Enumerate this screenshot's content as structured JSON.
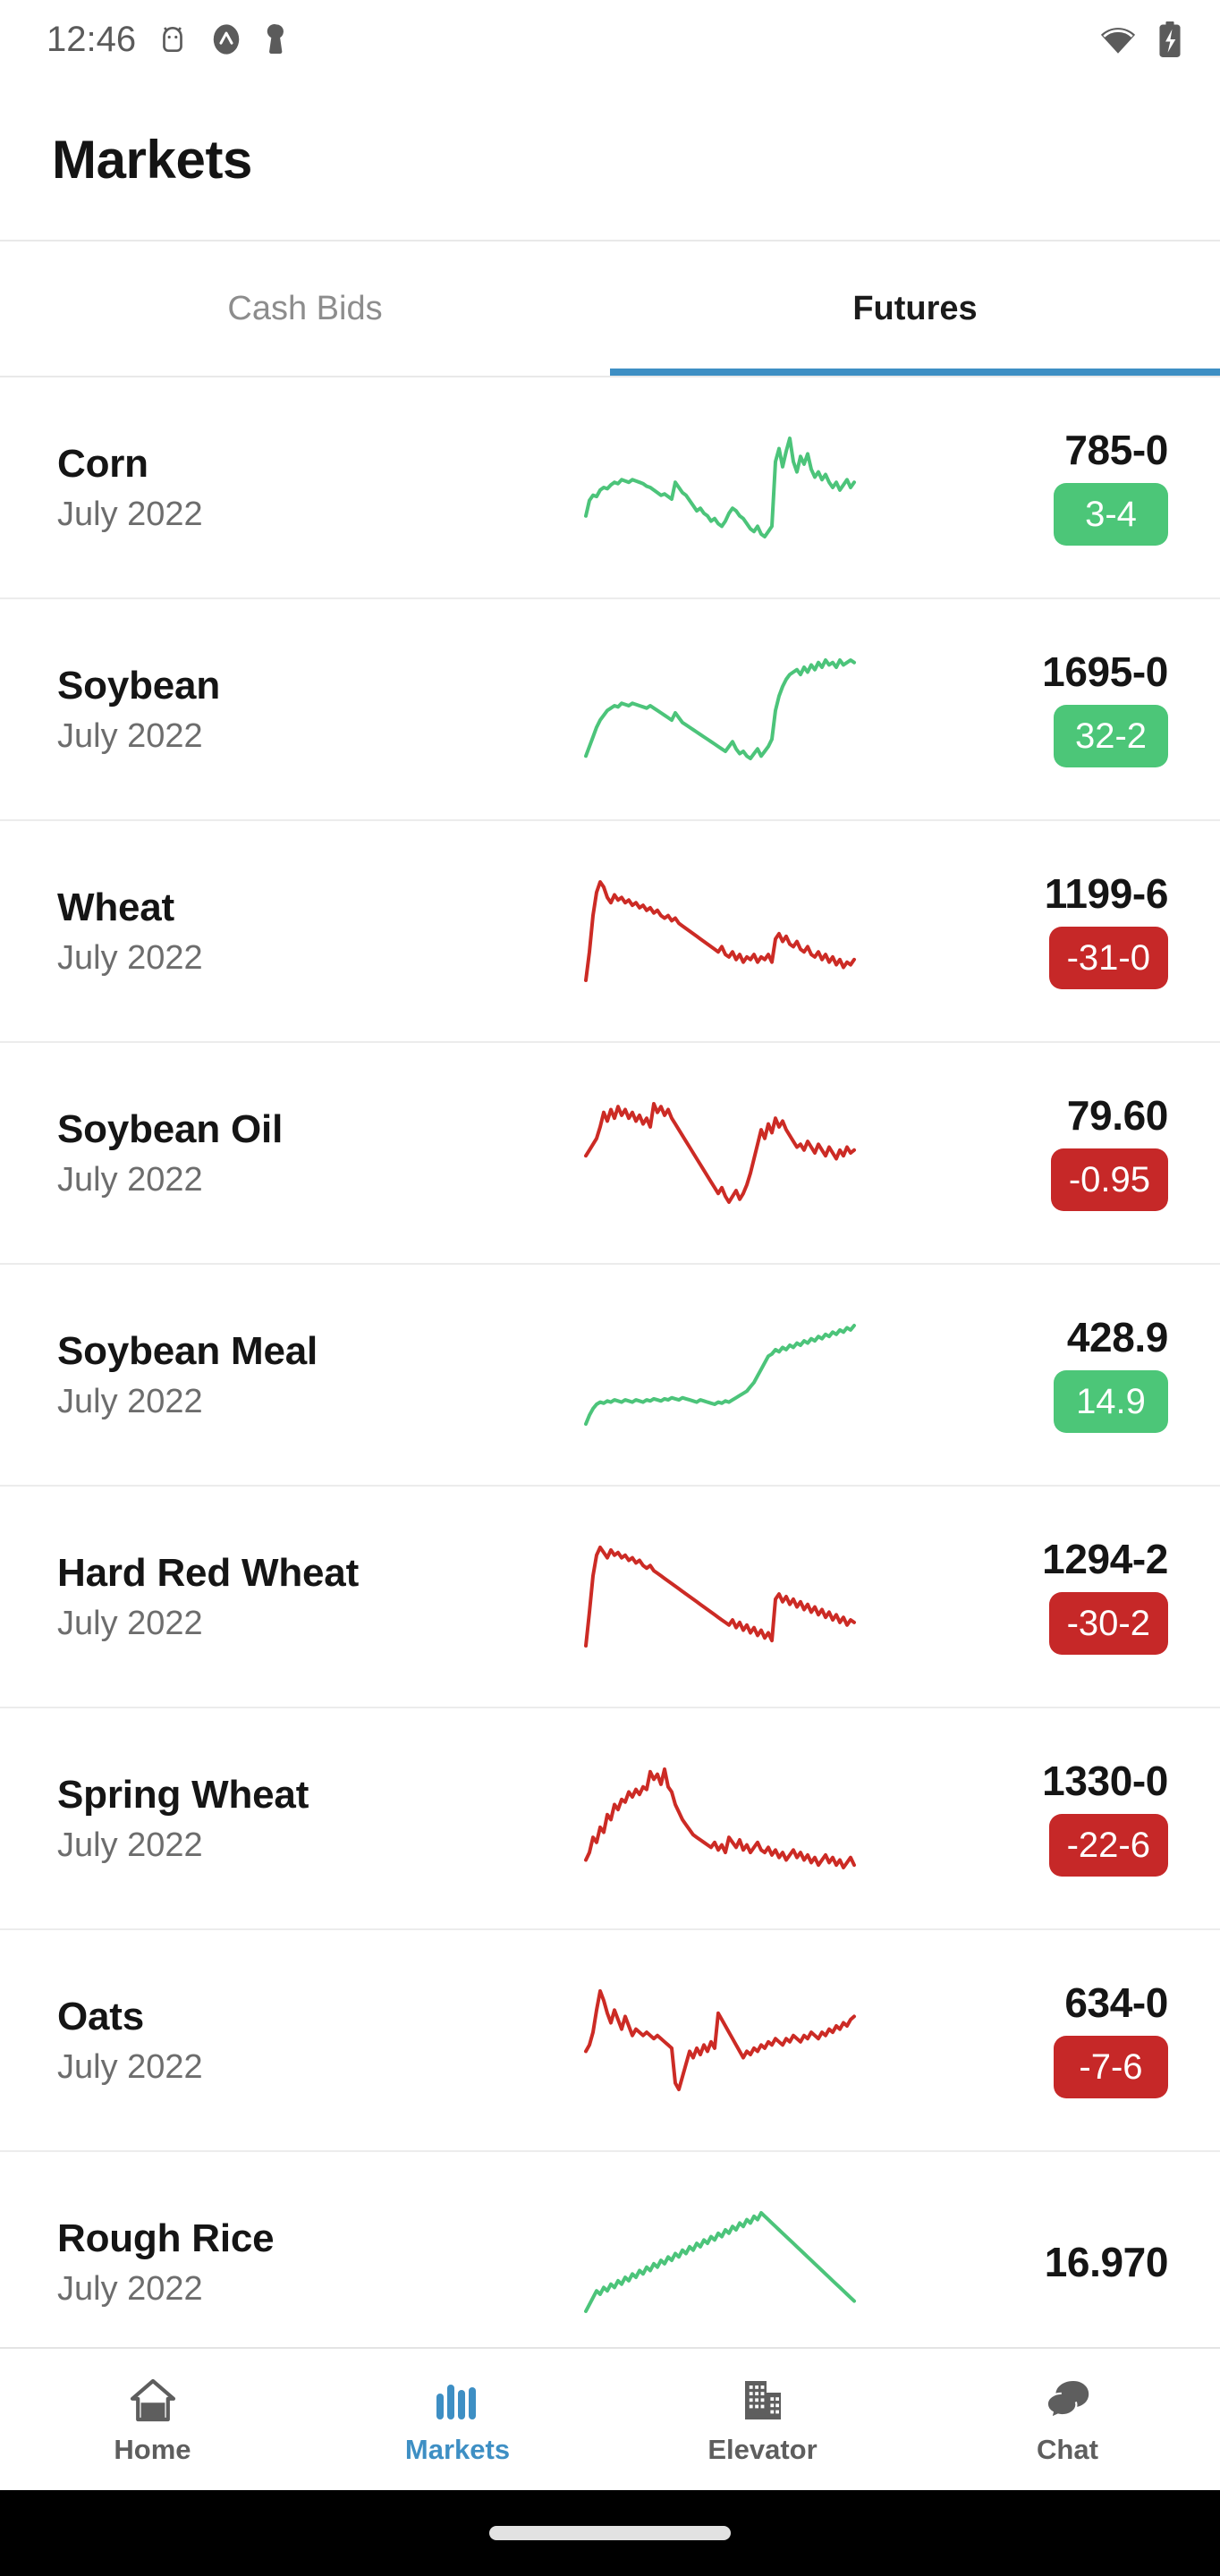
{
  "status_bar": {
    "time": "12:46",
    "icons": [
      "android-debug-icon",
      "app-badge-icon",
      "keyhole-icon"
    ],
    "right_icons": [
      "wifi-icon",
      "battery-charging-icon"
    ]
  },
  "app_bar": {
    "title": "Markets"
  },
  "tabs": [
    {
      "label": "Cash Bids",
      "active": false
    },
    {
      "label": "Futures",
      "active": true
    }
  ],
  "colors": {
    "accent_blue": "#3e8fc4",
    "up_green": "#4cc678",
    "down_red": "#c62828",
    "spark_green": "#4cc47a",
    "spark_red": "#cc2b25",
    "text_primary": "#151515",
    "text_secondary": "#6d6d6d"
  },
  "chart_data": {
    "type": "line",
    "title": "Futures intraday sparklines",
    "xlabel": "",
    "ylabel": "",
    "grid": false,
    "legend": "none",
    "series": [
      {
        "name": "Corn",
        "direction": "up",
        "color": "#4cc47a",
        "values": [
          18,
          30,
          34,
          33,
          38,
          40,
          39,
          42,
          44,
          43,
          46,
          45,
          44,
          46,
          45,
          44,
          43,
          41,
          40,
          38,
          36,
          34,
          35,
          33,
          31,
          44,
          40,
          36,
          34,
          30,
          26,
          22,
          24,
          20,
          18,
          14,
          16,
          12,
          10,
          14,
          20,
          24,
          22,
          18,
          16,
          12,
          8,
          6,
          10,
          4,
          2,
          6,
          10,
          60,
          70,
          56,
          68,
          78,
          60,
          52,
          64,
          58,
          66,
          54,
          48,
          52,
          46,
          50,
          44,
          40,
          44,
          38,
          42,
          46,
          40,
          44
        ]
      },
      {
        "name": "Soybean",
        "direction": "up",
        "color": "#4cc47a",
        "values": [
          6,
          14,
          22,
          30,
          36,
          40,
          44,
          46,
          48,
          47,
          50,
          49,
          48,
          50,
          49,
          48,
          47,
          46,
          48,
          46,
          44,
          42,
          40,
          38,
          36,
          42,
          38,
          34,
          32,
          30,
          28,
          26,
          24,
          22,
          20,
          18,
          16,
          14,
          12,
          10,
          14,
          18,
          12,
          8,
          10,
          6,
          4,
          8,
          12,
          6,
          10,
          14,
          20,
          44,
          56,
          64,
          70,
          74,
          76,
          78,
          74,
          80,
          76,
          82,
          78,
          84,
          80,
          86,
          82,
          84,
          80,
          86,
          82,
          84,
          86,
          84
        ]
      },
      {
        "name": "Wheat",
        "direction": "down",
        "color": "#cc2b25",
        "values": [
          8,
          30,
          58,
          76,
          84,
          80,
          72,
          68,
          74,
          70,
          72,
          68,
          70,
          66,
          68,
          64,
          66,
          62,
          64,
          60,
          62,
          58,
          56,
          58,
          54,
          56,
          52,
          50,
          48,
          46,
          44,
          42,
          40,
          38,
          36,
          34,
          32,
          30,
          34,
          28,
          26,
          30,
          24,
          28,
          22,
          26,
          24,
          28,
          22,
          26,
          24,
          28,
          22,
          40,
          44,
          38,
          42,
          36,
          34,
          38,
          32,
          30,
          34,
          28,
          26,
          30,
          24,
          28,
          22,
          26,
          20,
          24,
          18,
          22,
          20,
          24
        ]
      },
      {
        "name": "Soybean Oil",
        "direction": "down",
        "color": "#cc2b25",
        "values": [
          36,
          40,
          44,
          48,
          56,
          66,
          60,
          68,
          62,
          70,
          64,
          68,
          62,
          66,
          60,
          64,
          58,
          62,
          56,
          72,
          66,
          70,
          64,
          68,
          62,
          58,
          54,
          50,
          46,
          42,
          38,
          34,
          30,
          26,
          22,
          18,
          14,
          10,
          14,
          8,
          4,
          8,
          12,
          6,
          10,
          16,
          24,
          34,
          44,
          54,
          48,
          58,
          52,
          62,
          56,
          60,
          54,
          50,
          46,
          42,
          44,
          40,
          46,
          42,
          38,
          44,
          40,
          36,
          42,
          38,
          34,
          40,
          36,
          42,
          38,
          40
        ]
      },
      {
        "name": "Soybean Meal",
        "direction": "up",
        "color": "#4cc47a",
        "values": [
          8,
          16,
          22,
          26,
          28,
          27,
          29,
          28,
          30,
          29,
          28,
          30,
          29,
          28,
          30,
          29,
          28,
          30,
          29,
          31,
          30,
          29,
          31,
          30,
          32,
          31,
          30,
          32,
          31,
          30,
          29,
          28,
          30,
          29,
          28,
          27,
          26,
          28,
          27,
          29,
          28,
          30,
          32,
          34,
          36,
          38,
          42,
          46,
          52,
          58,
          64,
          70,
          72,
          76,
          74,
          78,
          76,
          80,
          78,
          82,
          80,
          84,
          82,
          86,
          84,
          88,
          86,
          90,
          88,
          92,
          90,
          94,
          92,
          96,
          94,
          98
        ]
      },
      {
        "name": "Hard Red Wheat",
        "direction": "down",
        "color": "#cc2b25",
        "values": [
          8,
          34,
          62,
          78,
          84,
          80,
          76,
          82,
          78,
          80,
          76,
          78,
          74,
          76,
          72,
          74,
          70,
          68,
          70,
          66,
          64,
          62,
          60,
          58,
          56,
          54,
          52,
          50,
          48,
          46,
          44,
          42,
          40,
          38,
          36,
          34,
          32,
          30,
          28,
          26,
          24,
          28,
          22,
          26,
          20,
          24,
          18,
          22,
          16,
          20,
          14,
          18,
          12,
          44,
          48,
          42,
          46,
          40,
          44,
          38,
          42,
          36,
          40,
          34,
          38,
          32,
          36,
          30,
          34,
          28,
          32,
          26,
          30,
          24,
          28,
          26
        ]
      },
      {
        "name": "Spring Wheat",
        "direction": "down",
        "color": "#cc2b25",
        "values": [
          16,
          22,
          34,
          30,
          42,
          38,
          52,
          48,
          60,
          56,
          64,
          62,
          70,
          66,
          72,
          68,
          74,
          72,
          86,
          80,
          84,
          76,
          88,
          74,
          70,
          60,
          54,
          48,
          44,
          40,
          36,
          34,
          32,
          30,
          28,
          26,
          30,
          24,
          28,
          22,
          34,
          30,
          26,
          32,
          24,
          28,
          22,
          26,
          30,
          24,
          22,
          26,
          20,
          24,
          18,
          22,
          16,
          20,
          24,
          18,
          22,
          16,
          20,
          14,
          18,
          12,
          16,
          20,
          14,
          18,
          12,
          16,
          10,
          14,
          18,
          12
        ]
      },
      {
        "name": "Oats",
        "direction": "down",
        "color": "#cc2b25",
        "values": [
          34,
          38,
          46,
          60,
          72,
          66,
          58,
          52,
          60,
          54,
          48,
          56,
          50,
          44,
          48,
          46,
          44,
          46,
          44,
          42,
          44,
          42,
          40,
          38,
          36,
          14,
          10,
          18,
          26,
          34,
          30,
          36,
          32,
          38,
          34,
          40,
          36,
          58,
          54,
          50,
          46,
          42,
          38,
          34,
          30,
          34,
          32,
          36,
          34,
          38,
          36,
          40,
          38,
          42,
          40,
          38,
          42,
          40,
          44,
          42,
          40,
          44,
          42,
          46,
          44,
          42,
          46,
          44,
          48,
          46,
          50,
          48,
          52,
          50,
          54,
          56
        ]
      },
      {
        "name": "Rough Rice",
        "direction": "up",
        "color": "#4cc47a",
        "values": [
          40,
          44,
          48,
          52,
          50,
          54,
          52,
          56,
          54,
          58,
          56,
          60,
          58,
          62,
          60,
          64,
          62,
          66,
          64,
          68,
          66,
          70,
          68,
          72,
          70,
          74,
          72,
          76,
          74,
          78,
          76,
          80,
          78,
          82,
          80,
          84,
          82,
          86,
          84,
          88,
          86,
          90,
          88,
          92,
          90,
          94,
          92,
          96,
          94,
          98,
          96,
          94,
          92,
          90,
          88,
          86,
          84,
          82,
          80,
          78,
          76,
          74,
          72,
          70,
          68,
          66,
          64,
          62,
          60,
          58,
          56,
          54,
          52,
          50,
          48,
          46
        ]
      }
    ]
  },
  "markets": {
    "rows": [
      {
        "commodity": "Corn",
        "contract": "July 2022",
        "price": "785-0",
        "change": "3-4",
        "direction": "up"
      },
      {
        "commodity": "Soybean",
        "contract": "July 2022",
        "price": "1695-0",
        "change": "32-2",
        "direction": "up"
      },
      {
        "commodity": "Wheat",
        "contract": "July 2022",
        "price": "1199-6",
        "change": "-31-0",
        "direction": "down"
      },
      {
        "commodity": "Soybean Oil",
        "contract": "July 2022",
        "price": "79.60",
        "change": "-0.95",
        "direction": "down"
      },
      {
        "commodity": "Soybean Meal",
        "contract": "July 2022",
        "price": "428.9",
        "change": "14.9",
        "direction": "up"
      },
      {
        "commodity": "Hard Red Wheat",
        "contract": "July 2022",
        "price": "1294-2",
        "change": "-30-2",
        "direction": "down"
      },
      {
        "commodity": "Spring Wheat",
        "contract": "July 2022",
        "price": "1330-0",
        "change": "-22-6",
        "direction": "down"
      },
      {
        "commodity": "Oats",
        "contract": "July 2022",
        "price": "634-0",
        "change": "-7-6",
        "direction": "down"
      },
      {
        "commodity": "Rough Rice",
        "contract": "July 2022",
        "price": "16.970",
        "change": "",
        "direction": "up"
      }
    ]
  },
  "bottom_nav": [
    {
      "label": "Home",
      "icon": "home-icon",
      "active": false
    },
    {
      "label": "Markets",
      "icon": "bar-chart-icon",
      "active": true
    },
    {
      "label": "Elevator",
      "icon": "building-icon",
      "active": false
    },
    {
      "label": "Chat",
      "icon": "chat-icon",
      "active": false
    }
  ]
}
